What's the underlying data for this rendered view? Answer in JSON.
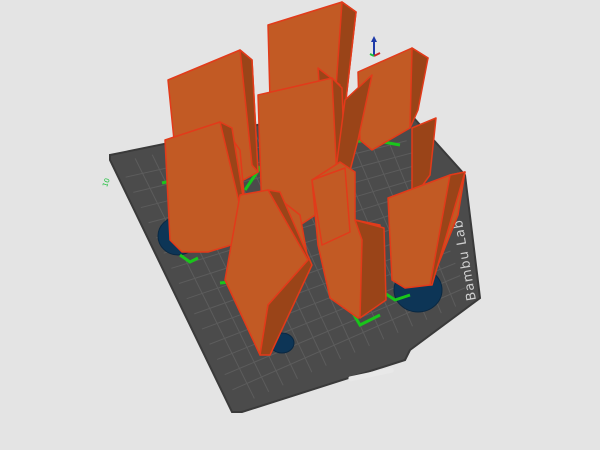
{
  "viewport": {
    "plate_label": "Bambu Lab",
    "axis_origin_label": "10",
    "colors": {
      "background": "#e4e4e4",
      "plate": "#4b4b4b",
      "plate_edge": "#3a3a3a",
      "grid": "#5c5c5c",
      "part_face": "#c25a24",
      "part_side": "#9a4418",
      "part_edge": "#e23a1a",
      "first_layer": "#19c51b",
      "disc": "#0d3556",
      "disc_edge": "#0a2842"
    },
    "icons": [
      "axis-gizmo-icon",
      "plate-handle-icon"
    ]
  }
}
